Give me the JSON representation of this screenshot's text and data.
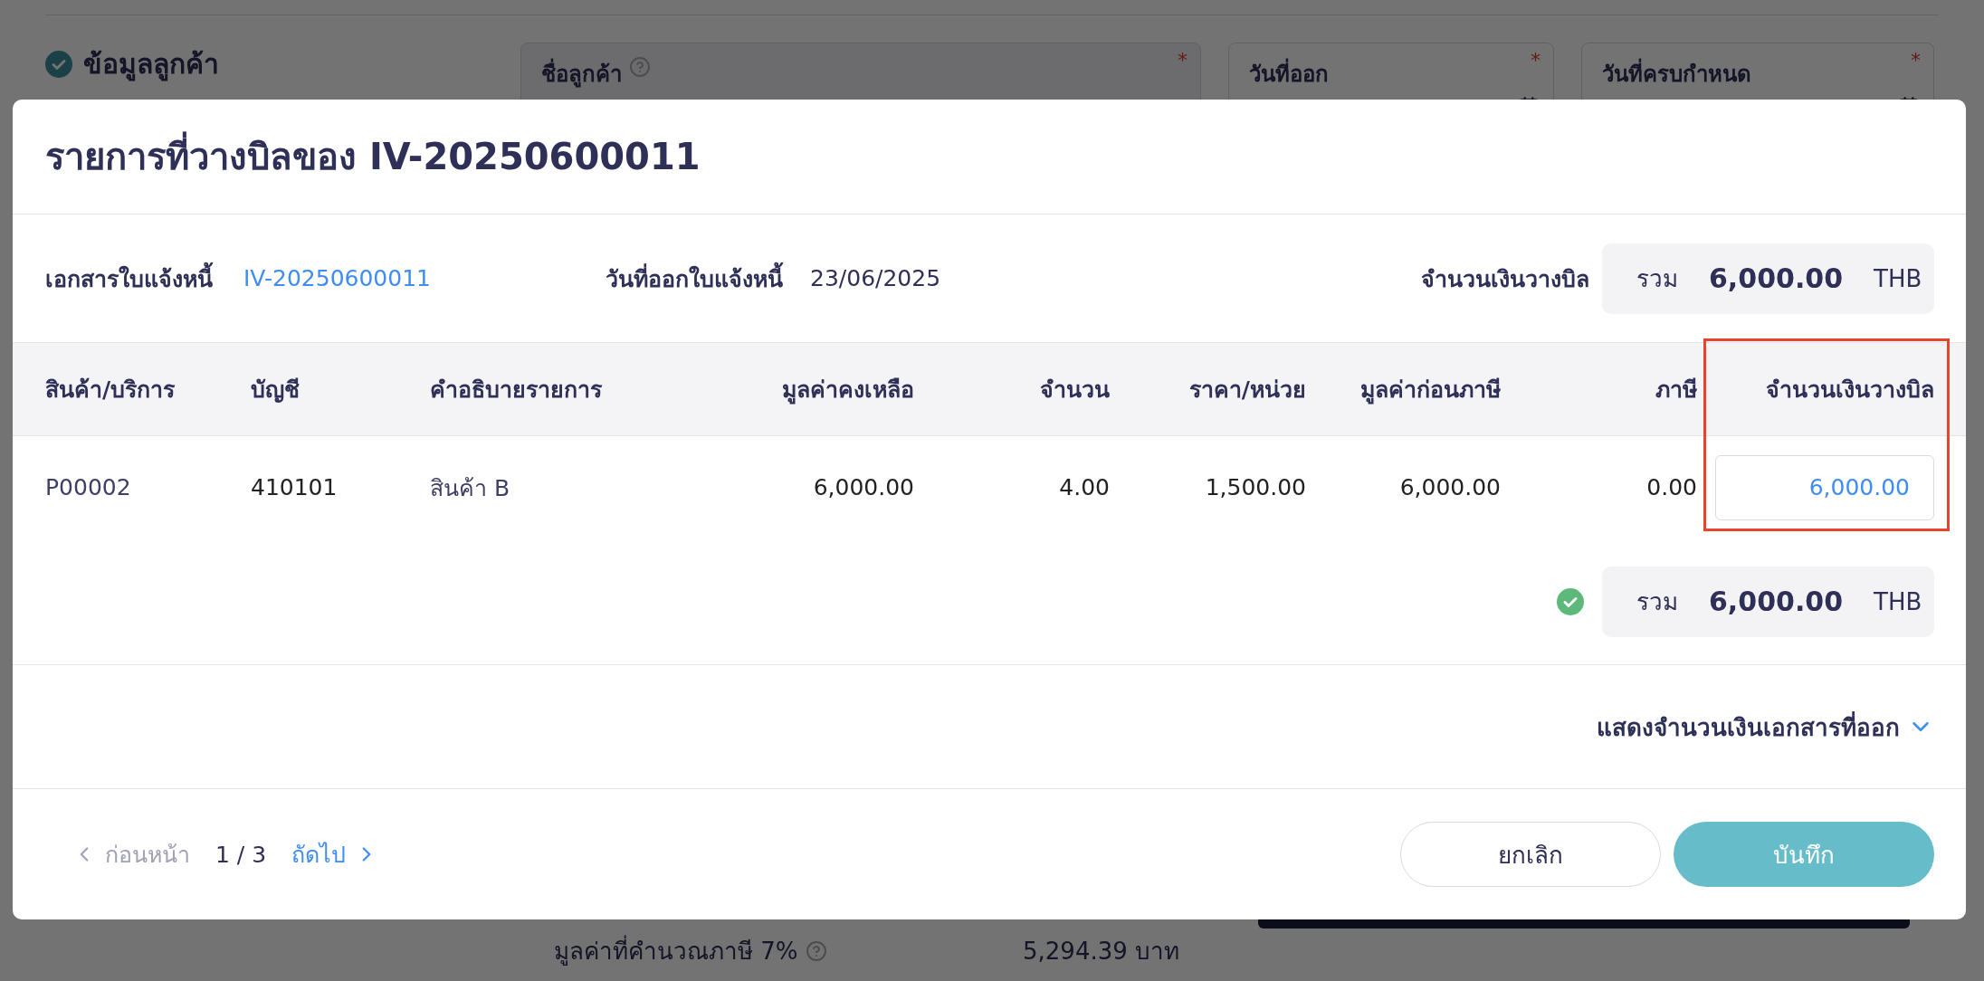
{
  "background": {
    "section_title": "ข้อมูลลูกค้า",
    "section_done": true,
    "fields": [
      {
        "label": "ชื่อลูกค้า",
        "help": true,
        "mark": "*",
        "kind": "text"
      },
      {
        "label": "วันที่ออก",
        "help": false,
        "mark": "*",
        "kind": "date"
      },
      {
        "label": "วันที่ครบกำหนด",
        "help": false,
        "mark": "*",
        "kind": "date"
      }
    ],
    "summary": {
      "label": "มูลค่าที่คำนวณภาษี 7%",
      "help": true,
      "value": "5,294.39 บาท"
    }
  },
  "modal": {
    "title": "รายการที่วางบิลของ IV-20250600011",
    "info": [
      {
        "label": "เอกสารใบแจ้งหนี้",
        "value": "IV-20250600011",
        "kind": "link"
      },
      {
        "label": "วันที่ออกใบแจ้งหนี้",
        "value": "23/06/2025",
        "kind": "text"
      }
    ],
    "billed_total": {
      "label": "จำนวนเงินวางบิล",
      "prefix": "รวม",
      "amount": "6,000.00",
      "currency": "THB"
    },
    "table": {
      "columns": [
        "สินค้า/บริการ",
        "บัญชี",
        "คำอธิบายรายการ",
        "มูลค่าคงเหลือ",
        "จำนวน",
        "ราคา/หน่วย",
        "มูลค่าก่อนภาษี",
        "ภาษี",
        "จำนวนเงินวางบิล"
      ],
      "rows": [
        {
          "cells": [
            "P00002",
            "410101",
            "สินค้า B",
            "6,000.00",
            "4.00",
            "1,500.00",
            "6,000.00",
            "0.00"
          ],
          "billed_amount": "6,000.00"
        }
      ]
    },
    "total": {
      "valid": true,
      "prefix": "รวม",
      "amount": "6,000.00",
      "currency": "THB"
    },
    "toggle": {
      "label": "แสดงจำนวนเงินเอกสารที่ออก",
      "expanded": false
    },
    "pagination": {
      "prev": "ก่อนหน้า",
      "prev_disabled": true,
      "page": "1 / 3",
      "next": "ถัดไป",
      "next_disabled": false
    },
    "buttons": [
      {
        "label": "ยกเลิก",
        "kind": "secondary"
      },
      {
        "label": "บันทึก",
        "kind": "primary"
      }
    ]
  }
}
